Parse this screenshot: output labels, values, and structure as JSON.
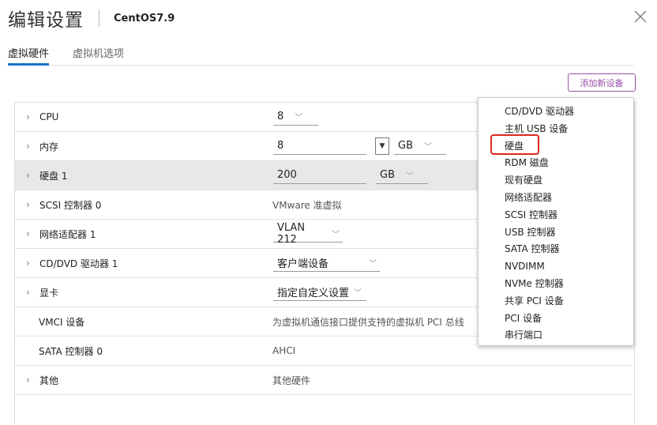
{
  "header": {
    "title": "编辑设置",
    "vm_name": "CentOS7.9"
  },
  "tabs": [
    {
      "label": "虚拟硬件",
      "active": true
    },
    {
      "label": "虚拟机选项",
      "active": false
    }
  ],
  "add_device_label": "添加新设备",
  "rows": [
    {
      "label": "CPU",
      "value": "8",
      "unit": ""
    },
    {
      "label": "内存",
      "value": "8",
      "unit": "GB"
    },
    {
      "label": "硬盘 1",
      "value": "200",
      "unit": "GB"
    },
    {
      "label": "SCSI 控制器 0",
      "value": "VMware 准虚拟"
    },
    {
      "label": "网络适配器 1",
      "value": "VLAN 212"
    },
    {
      "label": "CD/DVD 驱动器 1",
      "value": "客户端设备"
    },
    {
      "label": "显卡",
      "value": "指定自定义设置"
    },
    {
      "label": "VMCI 设备",
      "value": "为虚拟机通信接口提供支持的虚拟机 PCI 总线"
    },
    {
      "label": "SATA 控制器 0",
      "value": "AHCI"
    },
    {
      "label": "其他",
      "value": "其他硬件"
    }
  ],
  "menu": [
    "CD/DVD 驱动器",
    "主机 USB 设备",
    "硬盘",
    "RDM 磁盘",
    "现有硬盘",
    "网络适配器",
    "SCSI 控制器",
    "USB 控制器",
    "SATA 控制器",
    "NVDIMM",
    "NVMe 控制器",
    "共享 PCI 设备",
    "PCI 设备",
    "串行端口"
  ],
  "colors": {
    "accent": "#1a73c7",
    "button": "#9b4fa8",
    "highlight": "#e0261e"
  }
}
